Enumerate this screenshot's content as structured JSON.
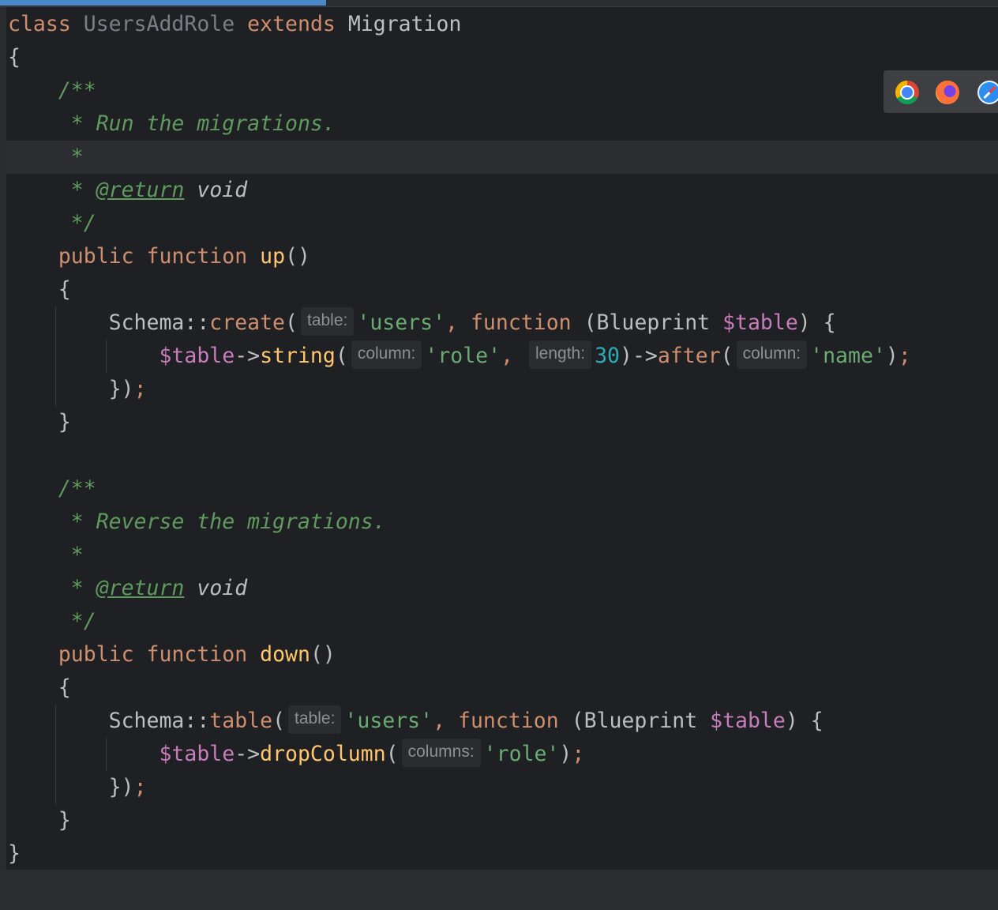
{
  "editor": {
    "lines": [
      [
        [
          "class",
          "kw"
        ],
        [
          " ",
          ""
        ],
        [
          "UsersAddRole",
          "unused"
        ],
        [
          " ",
          ""
        ],
        [
          "extends",
          "kw"
        ],
        [
          " ",
          ""
        ],
        [
          "Migration",
          "cls"
        ]
      ],
      [
        [
          "{",
          ""
        ]
      ],
      [
        [
          "    ",
          ""
        ],
        [
          "/**",
          "cm"
        ]
      ],
      [
        [
          "     ",
          ""
        ],
        [
          "* Run the migrations.",
          "cm"
        ]
      ],
      [
        [
          "     ",
          ""
        ],
        [
          "*",
          "cm"
        ]
      ],
      [
        [
          "     ",
          ""
        ],
        [
          "* ",
          "cm"
        ],
        [
          "@return",
          "tag"
        ],
        [
          " ",
          ""
        ],
        [
          "void",
          "cmtxt"
        ]
      ],
      [
        [
          "     ",
          ""
        ],
        [
          "*/",
          "cm"
        ]
      ],
      [
        [
          "    ",
          ""
        ],
        [
          "public",
          "kw"
        ],
        [
          " ",
          ""
        ],
        [
          "function",
          "kw"
        ],
        [
          " ",
          ""
        ],
        [
          "up",
          "fn"
        ],
        [
          "()",
          ""
        ]
      ],
      [
        [
          "    ",
          ""
        ],
        [
          "{",
          ""
        ]
      ],
      [
        [
          "        ",
          ""
        ],
        [
          "Schema::",
          ""
        ],
        [
          "create",
          "st"
        ],
        [
          "(",
          ""
        ],
        [
          "table:",
          "hint"
        ],
        [
          "'users'",
          "str"
        ],
        [
          ", ",
          "kw"
        ],
        [
          "function",
          "kw"
        ],
        [
          " (Blueprint ",
          ""
        ],
        [
          "$table",
          "var"
        ],
        [
          ") {",
          ""
        ]
      ],
      [
        [
          "            ",
          ""
        ],
        [
          "$table",
          "var"
        ],
        [
          "->",
          ""
        ],
        [
          "string",
          "mt"
        ],
        [
          "(",
          ""
        ],
        [
          "column:",
          "hint"
        ],
        [
          "'role'",
          "str"
        ],
        [
          ", ",
          "kw"
        ],
        [
          "length:",
          "hint"
        ],
        [
          "30",
          "num"
        ],
        [
          ")->",
          ""
        ],
        [
          "after",
          "st"
        ],
        [
          "(",
          ""
        ],
        [
          "column:",
          "hint"
        ],
        [
          "'name'",
          "str"
        ],
        [
          ")",
          ""
        ],
        [
          ";",
          "kw"
        ]
      ],
      [
        [
          "        ",
          ""
        ],
        [
          "})",
          ""
        ],
        [
          ";",
          "kw"
        ]
      ],
      [
        [
          "    ",
          ""
        ],
        [
          "}",
          ""
        ]
      ],
      [
        [
          "",
          ""
        ]
      ],
      [
        [
          "    ",
          ""
        ],
        [
          "/**",
          "cm"
        ]
      ],
      [
        [
          "     ",
          ""
        ],
        [
          "* Reverse the migrations.",
          "cm"
        ]
      ],
      [
        [
          "     ",
          ""
        ],
        [
          "*",
          "cm"
        ]
      ],
      [
        [
          "     ",
          ""
        ],
        [
          "* ",
          "cm"
        ],
        [
          "@return",
          "tag"
        ],
        [
          " ",
          ""
        ],
        [
          "void",
          "cmtxt"
        ]
      ],
      [
        [
          "     ",
          ""
        ],
        [
          "*/",
          "cm"
        ]
      ],
      [
        [
          "    ",
          ""
        ],
        [
          "public",
          "kw"
        ],
        [
          " ",
          ""
        ],
        [
          "function",
          "kw"
        ],
        [
          " ",
          ""
        ],
        [
          "down",
          "fn"
        ],
        [
          "()",
          ""
        ]
      ],
      [
        [
          "    ",
          ""
        ],
        [
          "{",
          ""
        ]
      ],
      [
        [
          "        ",
          ""
        ],
        [
          "Schema::",
          ""
        ],
        [
          "table",
          "st"
        ],
        [
          "(",
          ""
        ],
        [
          "table:",
          "hint"
        ],
        [
          "'users'",
          "str"
        ],
        [
          ", ",
          "kw"
        ],
        [
          "function",
          "kw"
        ],
        [
          " (Blueprint ",
          ""
        ],
        [
          "$table",
          "var"
        ],
        [
          ") {",
          ""
        ]
      ],
      [
        [
          "            ",
          ""
        ],
        [
          "$table",
          "var"
        ],
        [
          "->",
          ""
        ],
        [
          "dropColumn",
          "mt"
        ],
        [
          "(",
          ""
        ],
        [
          "columns:",
          "hint"
        ],
        [
          "'role'",
          "str"
        ],
        [
          ")",
          ""
        ],
        [
          ";",
          "kw"
        ]
      ],
      [
        [
          "        ",
          ""
        ],
        [
          "})",
          ""
        ],
        [
          ";",
          "kw"
        ]
      ],
      [
        [
          "    ",
          ""
        ],
        [
          "}",
          ""
        ]
      ],
      [
        [
          "}",
          ""
        ]
      ]
    ]
  },
  "browser_popup": {
    "icons": [
      "chrome-icon",
      "firefox-icon",
      "safari-icon"
    ]
  },
  "colors": {
    "keyword": "#cf8e6d",
    "string": "#6aab73",
    "comment": "#5f9b5f",
    "variable": "#c77dbb",
    "number": "#2aacb8",
    "background": "#1f2023"
  }
}
